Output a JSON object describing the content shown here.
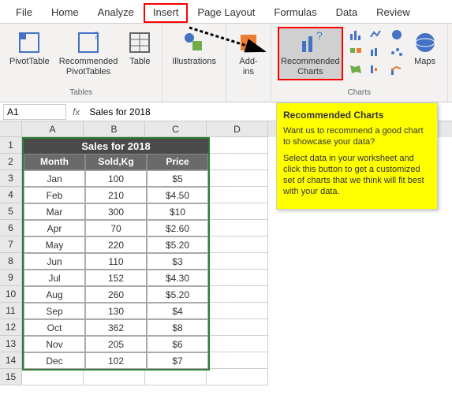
{
  "tabs": [
    "File",
    "Home",
    "Analyze",
    "Insert",
    "Page Layout",
    "Formulas",
    "Data",
    "Review"
  ],
  "active_tab": "Insert",
  "ribbon": {
    "tables_group": "Tables",
    "pivottable": "PivotTable",
    "recommended_pivottables": "Recommended\nPivotTables",
    "table": "Table",
    "illustrations": "Illustrations",
    "addins": "Add-\nins",
    "recommended_charts": "Recommended\nCharts",
    "charts_group": "Charts",
    "maps": "Maps"
  },
  "namebox": "A1",
  "formula": "Sales for 2018",
  "columns": [
    "A",
    "B",
    "C",
    "D"
  ],
  "table_title": "Sales for 2018",
  "headers": [
    "Month",
    "Sold,Kg",
    "Price"
  ],
  "rows": [
    {
      "n": 1
    },
    {
      "n": 2
    },
    {
      "n": 3,
      "month": "Jan",
      "sold": "100",
      "price": "$5"
    },
    {
      "n": 4,
      "month": "Feb",
      "sold": "210",
      "price": "$4.50"
    },
    {
      "n": 5,
      "month": "Mar",
      "sold": "300",
      "price": "$10"
    },
    {
      "n": 6,
      "month": "Apr",
      "sold": "70",
      "price": "$2.60"
    },
    {
      "n": 7,
      "month": "May",
      "sold": "220",
      "price": "$5.20"
    },
    {
      "n": 8,
      "month": "Jun",
      "sold": "110",
      "price": "$3"
    },
    {
      "n": 9,
      "month": "Jul",
      "sold": "152",
      "price": "$4.30"
    },
    {
      "n": 10,
      "month": "Aug",
      "sold": "260",
      "price": "$5.20"
    },
    {
      "n": 11,
      "month": "Sep",
      "sold": "130",
      "price": "$4"
    },
    {
      "n": 12,
      "month": "Oct",
      "sold": "362",
      "price": "$8"
    },
    {
      "n": 13,
      "month": "Nov",
      "sold": "205",
      "price": "$6"
    },
    {
      "n": 14,
      "month": "Dec",
      "sold": "102",
      "price": "$7"
    },
    {
      "n": 15
    }
  ],
  "tooltip": {
    "title": "Recommended Charts",
    "p1": "Want us to recommend a good chart to showcase your data?",
    "p2": "Select data in your worksheet and click this button to get a customized set of charts that we think will fit best with your data."
  },
  "chart_data": {
    "type": "table",
    "title": "Sales for 2018",
    "columns": [
      "Month",
      "Sold,Kg",
      "Price"
    ],
    "data": [
      [
        "Jan",
        100,
        5.0
      ],
      [
        "Feb",
        210,
        4.5
      ],
      [
        "Mar",
        300,
        10.0
      ],
      [
        "Apr",
        70,
        2.6
      ],
      [
        "May",
        220,
        5.2
      ],
      [
        "Jun",
        110,
        3.0
      ],
      [
        "Jul",
        152,
        4.3
      ],
      [
        "Aug",
        260,
        5.2
      ],
      [
        "Sep",
        130,
        4.0
      ],
      [
        "Oct",
        362,
        8.0
      ],
      [
        "Nov",
        205,
        6.0
      ],
      [
        "Dec",
        102,
        7.0
      ]
    ]
  }
}
